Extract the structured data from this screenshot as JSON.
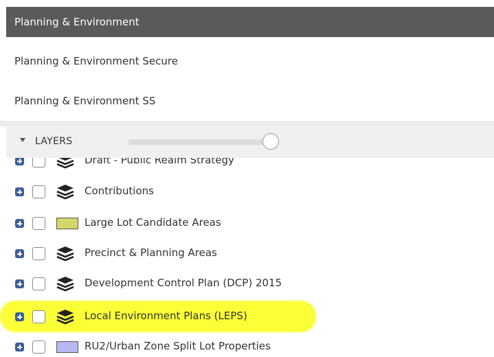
{
  "menu": {
    "active_item": "Planning & Environment",
    "items": [
      "Planning & Environment Secure",
      "Planning & Environment SS"
    ]
  },
  "layers_panel": {
    "header_label": "LAYERS",
    "opacity_slider_value": 1.0,
    "layers": [
      {
        "label": "Draft - Public Realm Strategy",
        "icon": "layers-stack-icon",
        "checked": false
      },
      {
        "label": "Contributions",
        "icon": "layers-stack-icon",
        "checked": false
      },
      {
        "label": "Large Lot Candidate Areas",
        "icon": "legend-swatch",
        "swatch_color": "#d6d66a",
        "checked": false
      },
      {
        "label": "Precinct & Planning Areas",
        "icon": "layers-stack-icon",
        "checked": false
      },
      {
        "label": "Development Control Plan (DCP) 2015",
        "icon": "layers-stack-icon",
        "checked": false
      },
      {
        "label": "Local Environment Plans (LEPS)",
        "icon": "layers-stack-icon",
        "checked": false,
        "highlighted": true
      },
      {
        "label": "RU2/Urban Zone Split Lot Properties",
        "icon": "legend-swatch",
        "swatch_color": "#b7b8f2",
        "checked": false
      }
    ]
  },
  "colors": {
    "header_bg": "#5a5a5a",
    "expand_icon": "#3d5f94",
    "highlight": "#fbff37"
  }
}
